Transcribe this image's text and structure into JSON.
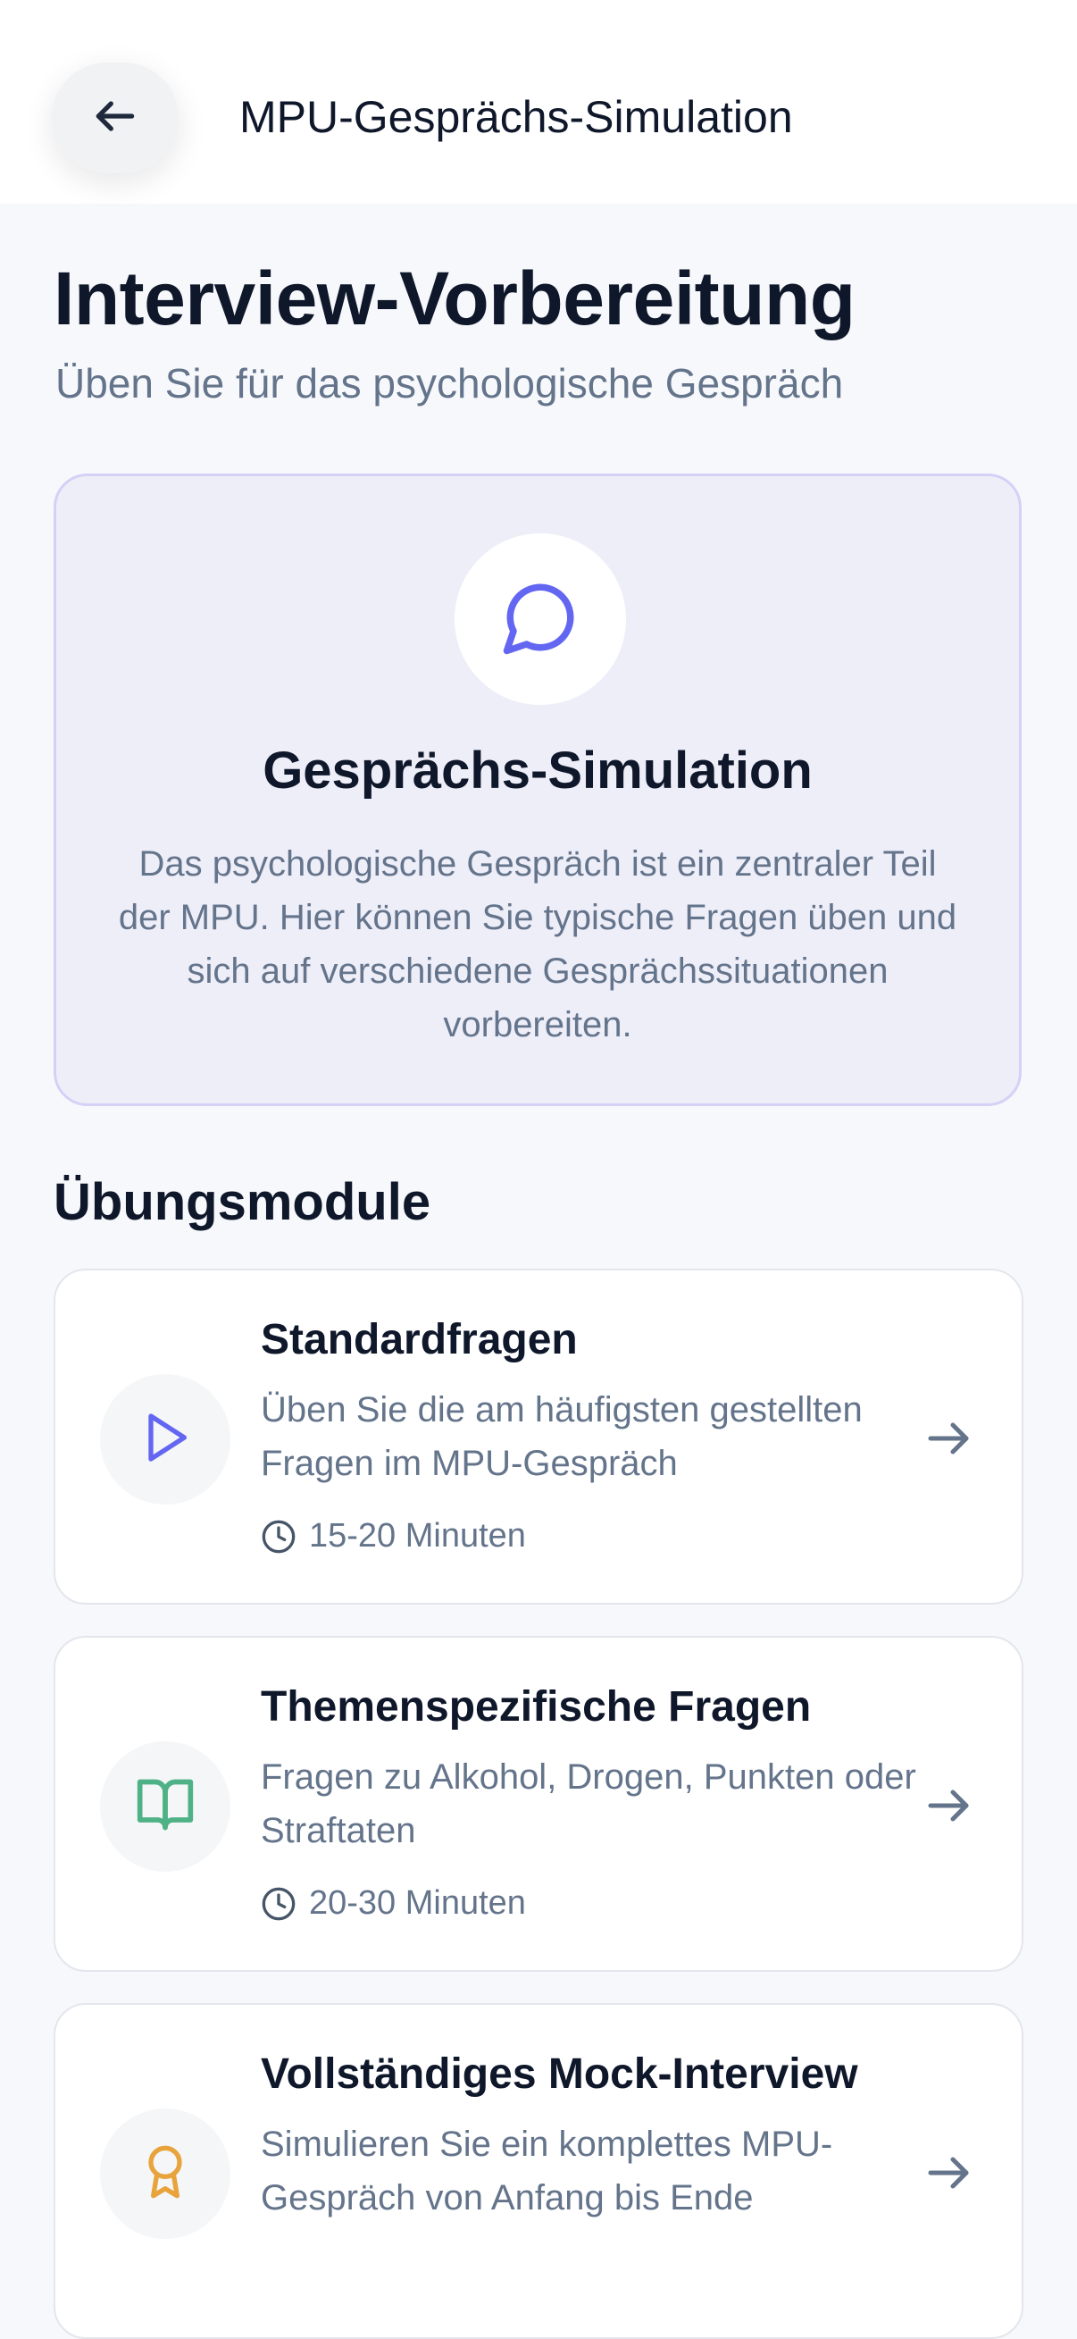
{
  "header": {
    "back_icon": "arrow-left-icon",
    "title": "MPU-Gesprächs-Simulation"
  },
  "page": {
    "title": "Interview-Vorbereitung",
    "subtitle": "Üben Sie für das psychologische Gespräch"
  },
  "hero": {
    "icon": "chat-bubble-icon",
    "title": "Gesprächs-Simulation",
    "text": "Das psychologische Gespräch ist ein zentraler Teil der MPU. Hier können Sie typische Fragen üben und sich auf verschiedene Gesprächssituationen vorbereiten."
  },
  "modules": {
    "heading": "Übungsmodule",
    "items": [
      {
        "icon": "play-icon",
        "title": "Standardfragen",
        "description": "Üben Sie die am häufigsten gestellten Fragen im MPU-Gespräch",
        "duration": "15-20 Minuten"
      },
      {
        "icon": "book-open-icon",
        "title": "Themenspezifische Fragen",
        "description": "Fragen zu Alkohol, Drogen, Punkten oder Straftaten",
        "duration": "20-30 Minuten"
      },
      {
        "icon": "award-icon",
        "title": "Vollständiges Mock-Interview",
        "description": "Simulieren Sie ein komplettes MPU-Gespräch von Anfang bis Ende",
        "duration": ""
      }
    ]
  },
  "colors": {
    "accent_indigo": "#6366f1",
    "accent_green": "#4fb286",
    "accent_amber": "#e8a33c",
    "text_primary": "#0f172a",
    "text_secondary": "#64748b"
  }
}
